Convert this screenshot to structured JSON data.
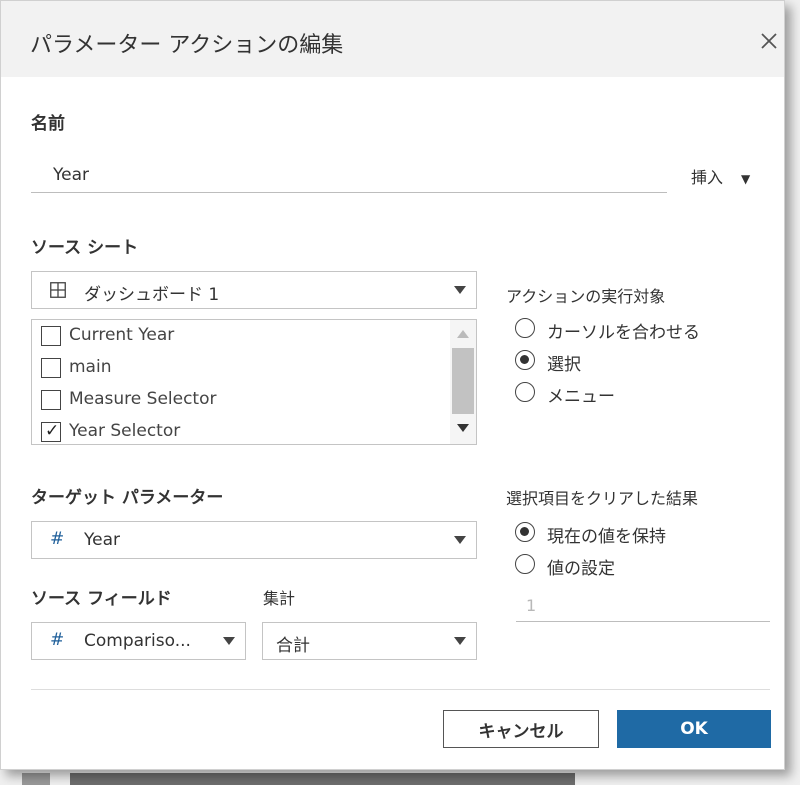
{
  "dialog": {
    "title": "パラメーター アクションの編集"
  },
  "name_section": {
    "label": "名前",
    "value": "Year",
    "insert_label": "挿入"
  },
  "source_sheets": {
    "label": "ソース シート",
    "dashboard_icon": "grid-icon",
    "dashboard_value": "ダッシュボード 1",
    "items": [
      {
        "label": "Current Year",
        "checked": false
      },
      {
        "label": "main",
        "checked": false
      },
      {
        "label": "Measure Selector",
        "checked": false
      },
      {
        "label": "Year Selector",
        "checked": true
      }
    ]
  },
  "run_action_on": {
    "label": "アクションの実行対象",
    "options": [
      {
        "label": "カーソルを合わせる",
        "selected": false
      },
      {
        "label": "選択",
        "selected": true
      },
      {
        "label": "メニュー",
        "selected": false
      }
    ]
  },
  "target_parameter": {
    "label": "ターゲット パラメーター",
    "icon": "#",
    "value": "Year"
  },
  "source_field": {
    "label": "ソース フィールド",
    "icon": "#",
    "value": "Compariso..."
  },
  "aggregation": {
    "label": "集計",
    "value": "合計"
  },
  "clear_selection": {
    "label": "選択項目をクリアした結果",
    "options": [
      {
        "label": "現在の値を保持",
        "selected": true
      },
      {
        "label": "値の設定",
        "selected": false
      }
    ],
    "set_value_placeholder": "1"
  },
  "buttons": {
    "cancel": "キャンセル",
    "ok": "OK"
  },
  "colors": {
    "ok_button": "#1f6aa5",
    "field_icon": "#1f5f9a"
  }
}
